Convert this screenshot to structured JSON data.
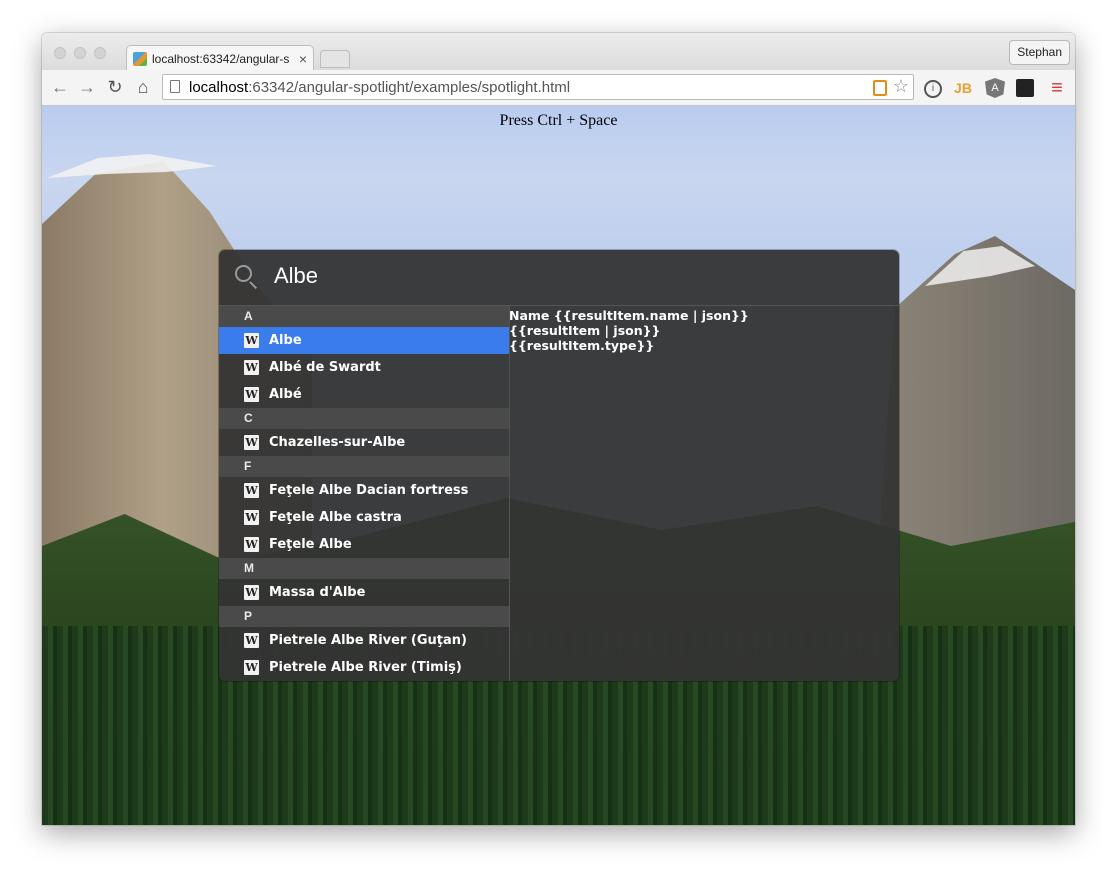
{
  "browser": {
    "tab_title": "localhost:63342/angular-s",
    "tab_close": "×",
    "profile_name": "Stephan",
    "url_host": "localhost",
    "url_rest": ":63342/angular-spotlight/examples/spotlight.html",
    "extensions": [
      "info-icon",
      "jetbrains-icon",
      "angular-icon",
      "glasses-icon",
      "menu-icon"
    ],
    "ext_labels": {
      "jb": "JB",
      "menu": "≡"
    }
  },
  "page": {
    "hint": "Press Ctrl + Space"
  },
  "spotlight": {
    "query": "Albe",
    "groups": [
      {
        "letter": "A",
        "items": [
          "Albe",
          "Albé de Swardt",
          "Albé"
        ]
      },
      {
        "letter": "C",
        "items": [
          "Chazelles-sur-Albe"
        ]
      },
      {
        "letter": "F",
        "items": [
          "Feţele Albe Dacian fortress",
          "Feţele Albe castra",
          "Feţele Albe"
        ]
      },
      {
        "letter": "M",
        "items": [
          "Massa d'Albe"
        ]
      },
      {
        "letter": "P",
        "items": [
          "Pietrele Albe River (Guţan)",
          "Pietrele Albe River (Timiş)"
        ]
      }
    ],
    "selected": "Albe",
    "wiki_glyph": "W",
    "detail": [
      "Name {{resultItem.name | json}}",
      "{{resultItem | json}}",
      "{{resultItem.type}}"
    ]
  },
  "colors": {
    "selected": "#3a7cec",
    "accent_rss": "#e58c17"
  }
}
